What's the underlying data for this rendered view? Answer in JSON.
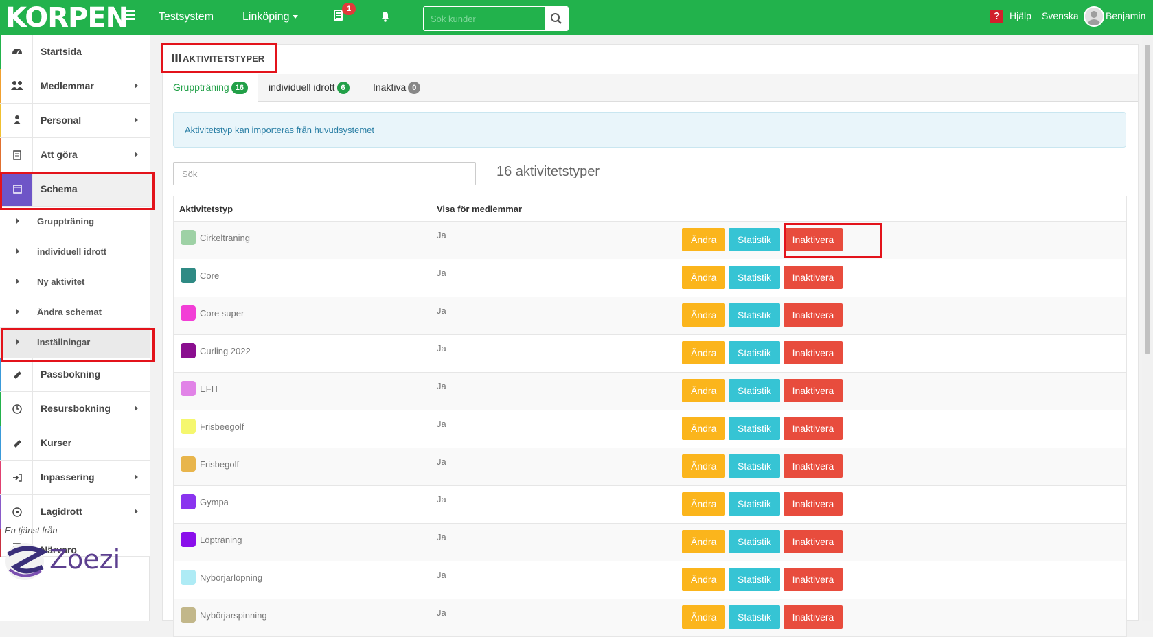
{
  "topbar": {
    "logo": "KORPEN",
    "system": "Testsystem",
    "location": "Linköping",
    "notification_count": "1",
    "search_placeholder": "Sök kunder",
    "help": "Hjälp",
    "language": "Svenska",
    "user": "Benjamin",
    "colors": {
      "bar": "#22b24c",
      "notification": "#e23a3a",
      "help": "#d0202c"
    }
  },
  "sidebar": {
    "items": [
      {
        "label": "Startsida",
        "icon": "dashboard-icon",
        "has_submenu": false
      },
      {
        "label": "Medlemmar",
        "icon": "users-icon",
        "has_submenu": true
      },
      {
        "label": "Personal",
        "icon": "user-icon",
        "has_submenu": true
      },
      {
        "label": "Att göra",
        "icon": "list-icon",
        "has_submenu": true
      },
      {
        "label": "Schema",
        "icon": "calendar-icon",
        "has_submenu": false,
        "active": true
      },
      {
        "label": "Passbokning",
        "icon": "ticket-icon",
        "has_submenu": false
      },
      {
        "label": "Resursbokning",
        "icon": "clock-icon",
        "has_submenu": true
      },
      {
        "label": "Kurser",
        "icon": "ticket-icon",
        "has_submenu": false
      },
      {
        "label": "Inpassering",
        "icon": "sign-in-icon",
        "has_submenu": true
      },
      {
        "label": "Lagidrott",
        "icon": "soccer-ball-icon",
        "has_submenu": true
      },
      {
        "label": "Närvaro",
        "icon": "list-icon",
        "has_submenu": false
      }
    ],
    "sub_items": [
      {
        "label": "Gruppträning"
      },
      {
        "label": "individuell idrott"
      },
      {
        "label": "Ny aktivitet"
      },
      {
        "label": "Ändra schemat"
      },
      {
        "label": "Inställningar",
        "active": true
      }
    ],
    "footer": "En tjänst från",
    "footer_logo": "Zoezi"
  },
  "main": {
    "title": "AKTIVITETSTYPER",
    "tabs": [
      {
        "label": "Gruppträning",
        "count": "16",
        "badge_color": "#22a048",
        "active": true
      },
      {
        "label": "individuell idrott",
        "count": "6",
        "badge_color": "#22a048",
        "active": false
      },
      {
        "label": "Inaktiva",
        "count": "0",
        "badge_color": "#888888",
        "active": false
      }
    ],
    "info": "Aktivitetstyp kan importeras från huvudsystemet",
    "search_placeholder": "Sök",
    "count_text": "16 aktivitetstyper",
    "columns": [
      "Aktivitetstyp",
      "Visa för medlemmar",
      ""
    ],
    "buttons": {
      "edit": "Ändra",
      "stats": "Statistik",
      "deactivate": "Inaktivera"
    },
    "rows": [
      {
        "name": "Cirkelträning",
        "color": "#9ed1a5",
        "visible": "Ja"
      },
      {
        "name": "Core",
        "color": "#2f8a84",
        "visible": "Ja"
      },
      {
        "name": "Core super",
        "color": "#f23ed6",
        "visible": "Ja"
      },
      {
        "name": "Curling 2022",
        "color": "#8a0e8f",
        "visible": "Ja"
      },
      {
        "name": "EFIT",
        "color": "#e183e7",
        "visible": "Ja"
      },
      {
        "name": "Frisbeegolf",
        "color": "#f5f76e",
        "visible": "Ja"
      },
      {
        "name": "Frisbegolf",
        "color": "#e8b54c",
        "visible": "Ja"
      },
      {
        "name": "Gympa",
        "color": "#8a34ef",
        "visible": "Ja"
      },
      {
        "name": "Löpträning",
        "color": "#8a0eeb",
        "visible": "Ja"
      },
      {
        "name": "Nybörjarlöpning",
        "color": "#aeebf5",
        "visible": "Ja"
      },
      {
        "name": "Nybörjarspinning",
        "color": "#c2b78a",
        "visible": "Ja"
      }
    ]
  }
}
